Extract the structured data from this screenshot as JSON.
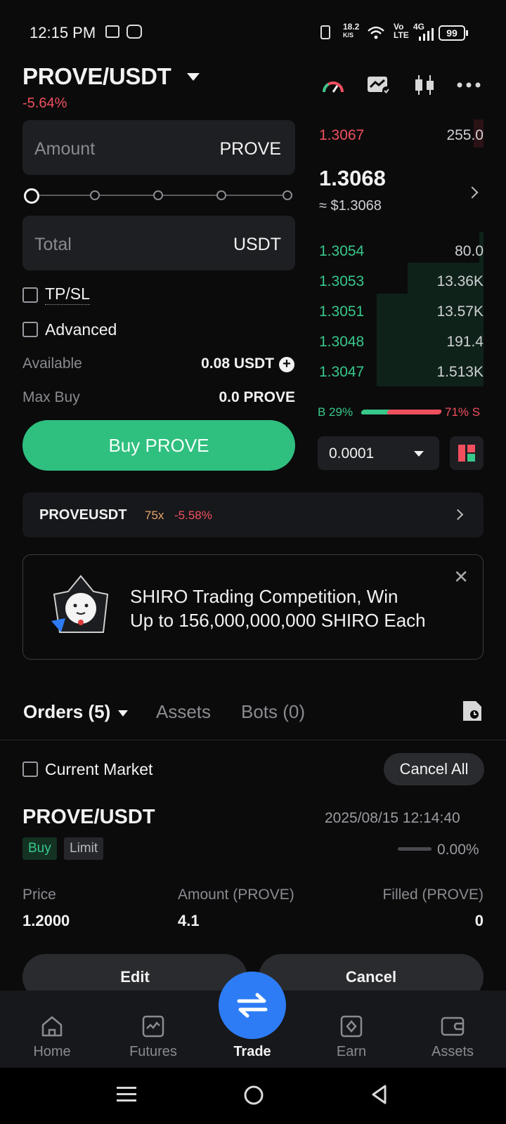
{
  "status_bar": {
    "time": "12:15 PM",
    "net_speed_top": "18.2",
    "net_speed_unit": "K/S",
    "volte_top": "Vo",
    "volte_bottom": "LTE",
    "network": "4G",
    "battery": "99"
  },
  "header": {
    "pair": "PROVE/USDT",
    "change": "-5.64%",
    "icons": [
      "gauge-icon",
      "chart-check-icon",
      "candlestick-icon",
      "more-icon"
    ]
  },
  "form": {
    "amount_placeholder": "Amount",
    "amount_unit": "PROVE",
    "total_placeholder": "Total",
    "total_unit": "USDT",
    "tpsl_label": "TP/SL",
    "advanced_label": "Advanced",
    "available_label": "Available",
    "available_value": "0.08 USDT",
    "maxbuy_label": "Max Buy",
    "maxbuy_value": "0.0 PROVE",
    "buy_button": "Buy PROVE"
  },
  "order_book": {
    "asks": [
      {
        "price": "1.3067",
        "qty": "255.0"
      }
    ],
    "last_price": "1.3068",
    "last_price_usd": "≈ $1.3068",
    "bids": [
      {
        "price": "1.3054",
        "qty": "80.0"
      },
      {
        "price": "1.3053",
        "qty": "13.36K"
      },
      {
        "price": "1.3051",
        "qty": "13.57K"
      },
      {
        "price": "1.3048",
        "qty": "191.4"
      },
      {
        "price": "1.3047",
        "qty": "1.513K"
      }
    ],
    "buy_ratio": "B 29%",
    "sell_ratio": "71% S",
    "buy_fraction": 0.29,
    "precision": "0.0001"
  },
  "futures": {
    "name": "PROVEUSDT",
    "leverage": "75x",
    "change": "-5.58%"
  },
  "promo": {
    "line1": "SHIRO Trading Competition, Win",
    "line2": "Up to 156,000,000,000 SHIRO Each"
  },
  "tabs": {
    "orders": "Orders (5)",
    "assets": "Assets",
    "bots": "Bots (0)"
  },
  "orders": {
    "current_market_label": "Current Market",
    "cancel_all": "Cancel All",
    "items": [
      {
        "pair": "PROVE/USDT",
        "time": "2025/08/15 12:14:40",
        "side": "Buy",
        "type": "Limit",
        "filled_pct": "0.00%",
        "price_label": "Price",
        "price": "1.2000",
        "amount_label": "Amount (PROVE)",
        "amount": "4.1",
        "filled_label": "Filled (PROVE)",
        "filled": "0",
        "edit": "Edit",
        "cancel": "Cancel"
      }
    ]
  },
  "nav": {
    "home": "Home",
    "futures": "Futures",
    "trade": "Trade",
    "earn": "Earn",
    "assets": "Assets"
  },
  "colors": {
    "green": "#38c88a",
    "red": "#f0505e",
    "accent": "#2d7cf6",
    "buy_button": "#2fbf7f"
  }
}
